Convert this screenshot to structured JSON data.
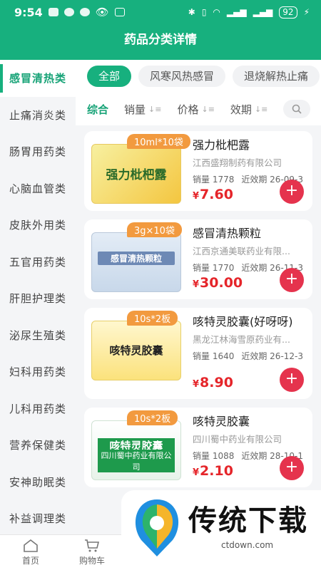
{
  "status": {
    "time": "9:54",
    "battery": "92"
  },
  "header": {
    "title": "药品分类详情"
  },
  "sidebar": {
    "items": [
      {
        "label": "感冒清热类",
        "active": true
      },
      {
        "label": "止痛消炎类"
      },
      {
        "label": "肠胃用药类"
      },
      {
        "label": "心脑血管类"
      },
      {
        "label": "皮肤外用类"
      },
      {
        "label": "五官用药类"
      },
      {
        "label": "肝胆护理类"
      },
      {
        "label": "泌尿生殖类"
      },
      {
        "label": "妇科用药类"
      },
      {
        "label": "儿科用药类"
      },
      {
        "label": "营养保健类"
      },
      {
        "label": "安神助眠类"
      },
      {
        "label": "补益调理类"
      }
    ]
  },
  "chips": [
    "全部",
    "风寒风热感冒",
    "退烧解热止痛"
  ],
  "sort": {
    "options": [
      "综合",
      "销量",
      "价格",
      "效期"
    ],
    "arrow": "↓≡"
  },
  "products": [
    {
      "spec": "10ml*10袋",
      "name": "强力枇杷露",
      "box_title": "强力枇杷露",
      "company": "江西盛翔制药有限公司",
      "sales": "销量 1778",
      "expiry": "近效期 26-09-3",
      "currency": "¥",
      "price": "7.60"
    },
    {
      "spec": "3g×10袋",
      "name": "感冒清热颗粒",
      "box_title": "感冒清热颗粒",
      "company": "江西京通美联药业有限...",
      "sales": "销量 1770",
      "expiry": "近效期 26-11-3",
      "currency": "¥",
      "price": "30.00"
    },
    {
      "spec": "10s*2板",
      "name": "咳特灵胶囊(好呀呀)",
      "box_title": "咳特灵胶囊",
      "company": "黑龙江林海雪原药业有...",
      "sales": "销量 1640",
      "expiry": "近效期 26-12-3",
      "currency": "¥",
      "price": "8.90"
    },
    {
      "spec": "10s*2板",
      "name": "咳特灵胶囊",
      "box_title": "咳特灵胶囊",
      "box_sub": "四川蜀中药业有限公司",
      "company": "四川蜀中药业有限公司",
      "sales": "销量 1088",
      "expiry": "近效期 28-10-1",
      "currency": "¥",
      "price": "2.10"
    }
  ],
  "add_symbol": "+",
  "tabbar": {
    "home": "首页",
    "cart": "购物车"
  },
  "watermark": {
    "text": "传统下载",
    "url": "ctdown.com"
  },
  "colors": {
    "brand": "#17b07e",
    "price": "#e5252a",
    "spec_badge": "#f29a3f",
    "add_button": "#e5334d"
  }
}
